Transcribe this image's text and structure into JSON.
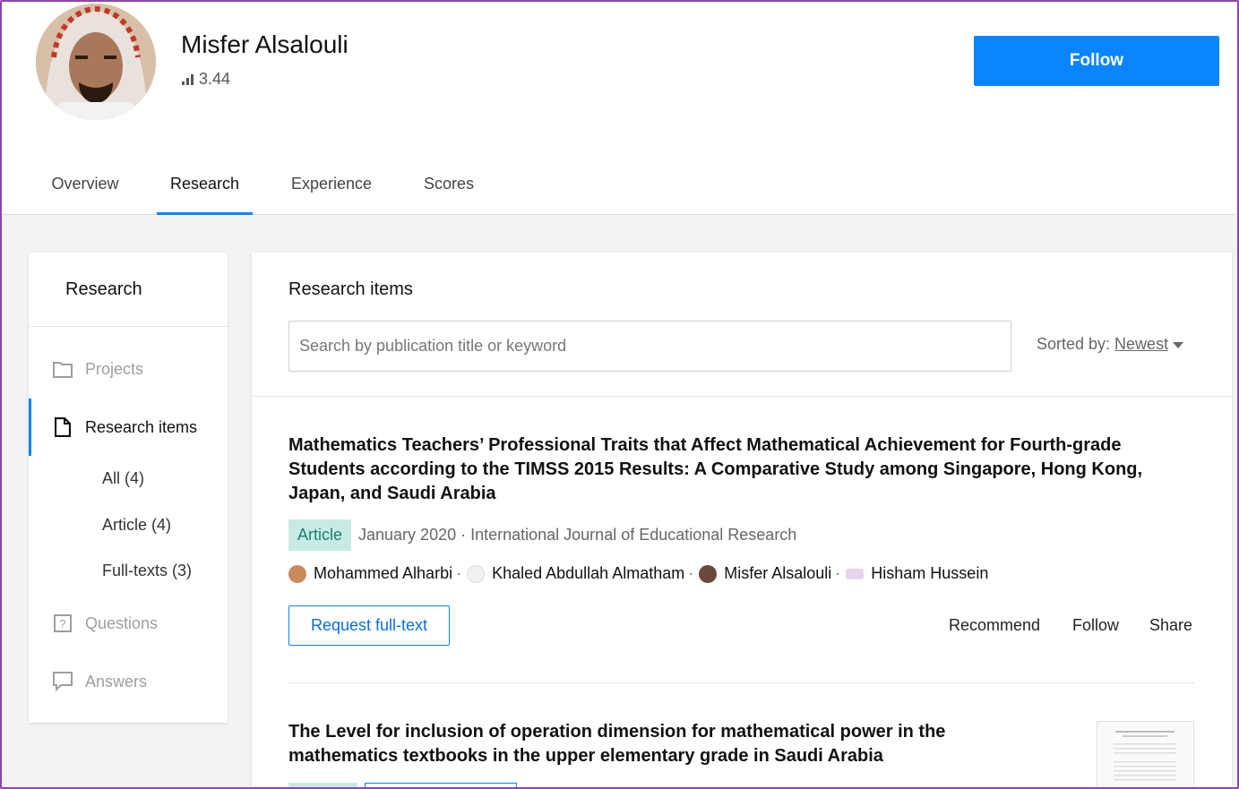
{
  "profile": {
    "name": "Misfer Alsalouli",
    "score": "3.44",
    "follow_label": "Follow"
  },
  "tabs": [
    {
      "label": "Overview"
    },
    {
      "label": "Research"
    },
    {
      "label": "Experience"
    },
    {
      "label": "Scores"
    }
  ],
  "active_tab": "Research",
  "sidebar": {
    "title": "Research",
    "items": [
      {
        "label": "Projects",
        "icon": "folder-icon"
      },
      {
        "label": "Research items",
        "icon": "document-icon"
      },
      {
        "label": "Questions",
        "icon": "question-icon"
      },
      {
        "label": "Answers",
        "icon": "speech-bubble-icon"
      }
    ],
    "sub_items": [
      {
        "label": "All (4)"
      },
      {
        "label": "Article (4)"
      },
      {
        "label": "Full-texts (3)"
      }
    ]
  },
  "main": {
    "title": "Research items",
    "search_placeholder": "Search by publication title or keyword",
    "sort_label": "Sorted by:",
    "sort_value": "Newest"
  },
  "publications": [
    {
      "title": "Mathematics Teachers’ Professional Traits that Affect Mathematical Achievement for Fourth-grade Students according to the TIMSS 2015 Results: A Comparative Study among Singapore, Hong Kong, Japan, and Saudi Arabia",
      "type": "Article",
      "date_journal": "January 2020 · International Journal of Educational Research",
      "authors": [
        {
          "name": "Mohammed Alharbi"
        },
        {
          "name": "Khaled Abdullah Almatham"
        },
        {
          "name": "Misfer Alsalouli"
        },
        {
          "name": "Hisham Hussein"
        }
      ],
      "request_label": "Request full-text",
      "actions": {
        "recommend": "Recommend",
        "follow": "Follow",
        "share": "Share"
      }
    },
    {
      "title": "The Level for inclusion of operation dimension for mathematical power in the mathematics textbooks in the upper elementary grade in Saudi Arabia"
    }
  ],
  "colors": {
    "accent": "#0a84ff",
    "badge_bg": "#c7ebe4",
    "badge_text": "#1a7f70",
    "frame": "#8e44ad"
  }
}
